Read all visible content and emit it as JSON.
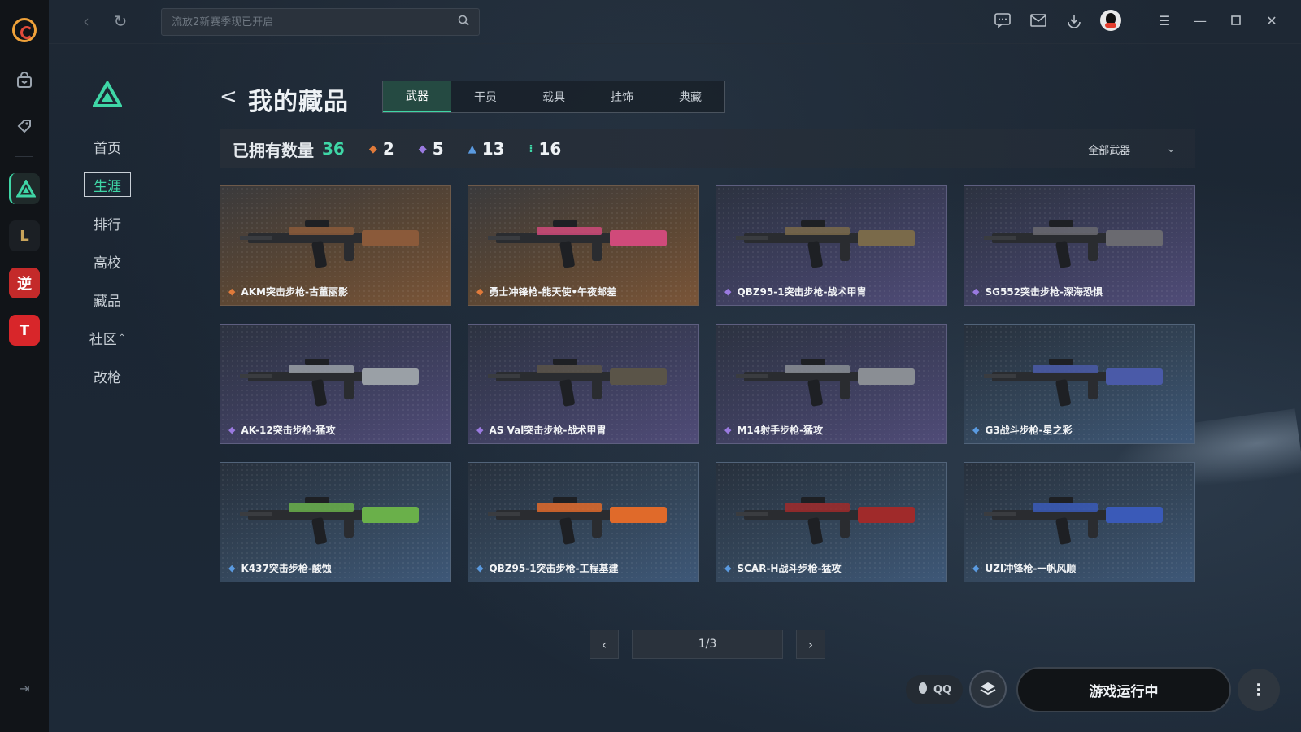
{
  "topbar": {
    "search_placeholder": "流放2新赛季现已开启"
  },
  "nav": {
    "items": [
      {
        "label": "首页"
      },
      {
        "label": "生涯"
      },
      {
        "label": "排行"
      },
      {
        "label": "高校"
      },
      {
        "label": "藏品"
      },
      {
        "label": "社区"
      },
      {
        "label": "改枪"
      }
    ],
    "active": "生涯",
    "community_caret": "^"
  },
  "page": {
    "title": "我的藏品",
    "back_glyph": "<"
  },
  "tabs": [
    {
      "label": "武器"
    },
    {
      "label": "干员"
    },
    {
      "label": "载具"
    },
    {
      "label": "挂饰"
    },
    {
      "label": "典藏"
    }
  ],
  "active_tab": "武器",
  "stats": {
    "label": "已拥有数量",
    "total": "36",
    "rarities": [
      {
        "color": "#e07a3a",
        "count": "2"
      },
      {
        "color": "#9a7ae0",
        "count": "5"
      },
      {
        "color": "#5a9ae0",
        "count": "13"
      },
      {
        "color": "#3fd6a6",
        "count": "16"
      }
    ],
    "filter_label": "全部武器"
  },
  "items": [
    {
      "name": "AKM突击步枪-古董丽影",
      "rarity": "orange",
      "gem_color": "#e07a3a"
    },
    {
      "name": "勇士冲锋枪-能天使•午夜邮差",
      "rarity": "orange",
      "gem_color": "#e07a3a"
    },
    {
      "name": "QBZ95-1突击步枪-战术甲胄",
      "rarity": "purple",
      "gem_color": "#9a7ae0"
    },
    {
      "name": "SG552突击步枪-深海恐惧",
      "rarity": "purple",
      "gem_color": "#9a7ae0"
    },
    {
      "name": "AK-12突击步枪-猛攻",
      "rarity": "purple",
      "gem_color": "#9a7ae0"
    },
    {
      "name": "AS Val突击步枪-战术甲胄",
      "rarity": "purple",
      "gem_color": "#9a7ae0"
    },
    {
      "name": "M14射手步枪-猛攻",
      "rarity": "purple",
      "gem_color": "#9a7ae0"
    },
    {
      "name": "G3战斗步枪-星之彩",
      "rarity": "blue",
      "gem_color": "#5a9ae0"
    },
    {
      "name": "K437突击步枪-酸蚀",
      "rarity": "blue",
      "gem_color": "#5a9ae0"
    },
    {
      "name": "QBZ95-1突击步枪-工程基建",
      "rarity": "blue",
      "gem_color": "#5a9ae0"
    },
    {
      "name": "SCAR-H战斗步枪-猛攻",
      "rarity": "blue",
      "gem_color": "#5a9ae0"
    },
    {
      "name": "UZI冲锋枪-一帆风顺",
      "rarity": "blue",
      "gem_color": "#5a9ae0"
    }
  ],
  "pagination": {
    "current": "1/3"
  },
  "footer": {
    "qq_label": "QQ",
    "run_label": "游戏运行中"
  }
}
